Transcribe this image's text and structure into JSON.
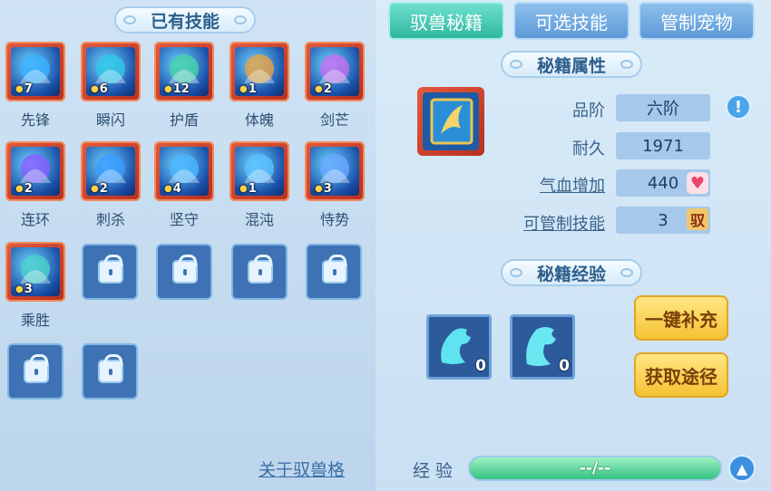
{
  "left_panel": {
    "title": "已有技能",
    "skills": [
      {
        "name": "先锋",
        "count": "7"
      },
      {
        "name": "瞬闪",
        "count": "6"
      },
      {
        "name": "护盾",
        "count": "12"
      },
      {
        "name": "体魄",
        "count": "1"
      },
      {
        "name": "剑芒",
        "count": "2"
      },
      {
        "name": "连环",
        "count": "2"
      },
      {
        "name": "刺杀",
        "count": "2"
      },
      {
        "name": "坚守",
        "count": "4"
      },
      {
        "name": "混沌",
        "count": "1"
      },
      {
        "name": "恃势",
        "count": "3"
      },
      {
        "name": "乘胜",
        "count": "3"
      }
    ],
    "locked_slots": 6,
    "about_link": "关于驭兽格"
  },
  "tabs": [
    {
      "label": "驭兽秘籍",
      "active": true
    },
    {
      "label": "可选技能",
      "active": false
    },
    {
      "label": "管制宠物",
      "active": false
    }
  ],
  "attributes": {
    "title": "秘籍属性",
    "rank_label": "品阶",
    "rank_value": "六阶",
    "durability_label": "耐久",
    "durability_value": "1971",
    "hp_label": "气血增加",
    "hp_value": "440",
    "control_label": "可管制技能",
    "control_value": "3",
    "control_badge": "驭",
    "info_icon": "exclamation-icon",
    "heart_icon": "heart-icon"
  },
  "experience": {
    "title": "秘籍经验",
    "items": [
      {
        "count": "0"
      },
      {
        "count": "0"
      }
    ],
    "btn_refill": "一键补充",
    "btn_obtain": "获取途径",
    "exp_label": "经 验",
    "exp_value": "--/--",
    "exp_fraction": 1.0
  },
  "colors": {
    "active_tab": "#2fb79f",
    "skill_frame": "#c23a24",
    "button_yellow": "#f5c233"
  }
}
